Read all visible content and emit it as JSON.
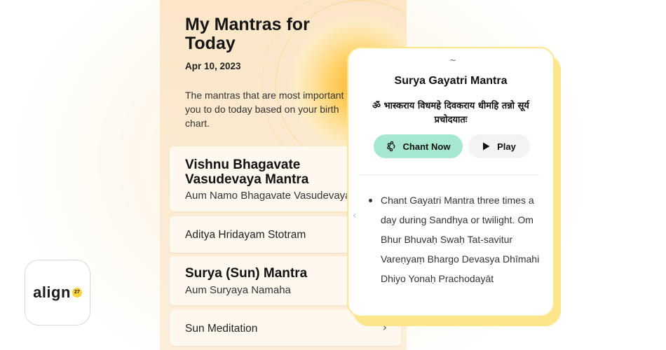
{
  "screen": {
    "title": "My Mantras for Today",
    "date": "Apr 10, 2023",
    "description": "The mantras that are most important for you to do today based on your birth chart."
  },
  "mantras": [
    {
      "name": "Vishnu Bhagavate Vasudevaya Mantra",
      "subtitle": "Aum Namo Bhagavate Vasudevaya"
    },
    {
      "name": "Aditya Hridayam Stotram"
    },
    {
      "name": "Surya (Sun) Mantra",
      "subtitle": "Aum Suryaya Namaha"
    },
    {
      "name": "Sun Meditation"
    }
  ],
  "popup": {
    "handle": "~",
    "title": "Surya Gayatri Mantra",
    "sanskrit": "ॐ भास्कराय विधमहे दिवकराय धीमहि तन्नो सूर्य प्रचोदयातः",
    "chant_label": "Chant Now",
    "play_label": "Play",
    "instruction": "Chant Gayatri Mantra three times a day during Sandhya or twilight. Om Bhur Bhuvaḥ Swaḥ Tat-savitur Vareṇyaṃ Bhargo Devasya Dhīmahi Dhiyo Yonaḥ Prachodayāt"
  },
  "logo": {
    "text": "align",
    "badge": "27"
  },
  "colors": {
    "accent_green": "#a6e8cf",
    "popup_border": "#fde58b",
    "sun": "#ffb938",
    "panel_bg": "#fbe6c8"
  },
  "icons": {
    "chant": "beads-icon",
    "play": "play-icon",
    "chevron": "chevron-right-icon"
  }
}
